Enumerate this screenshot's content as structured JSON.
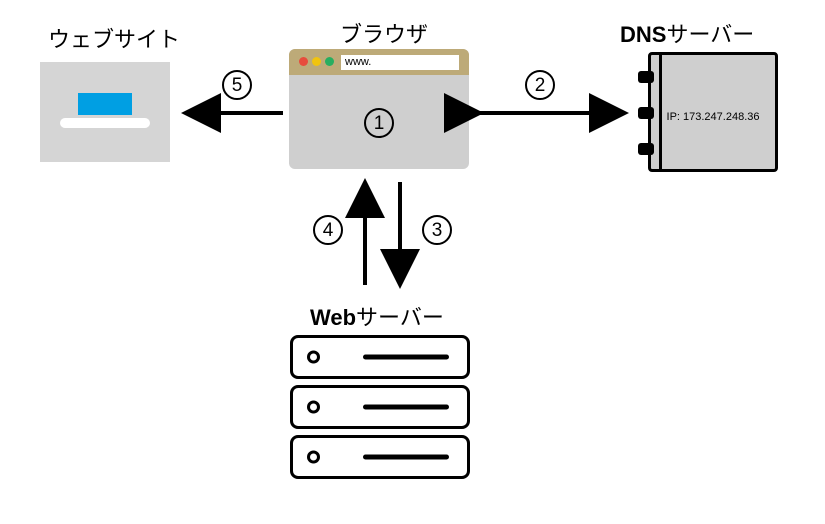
{
  "labels": {
    "website": "ウェブサイト",
    "browser": "ブラウザ",
    "dns_prefix": "DNS",
    "dns_suffix": "サーバー",
    "webserver_prefix": "Web",
    "webserver_suffix": "サーバー"
  },
  "browser": {
    "url_text": "www."
  },
  "dns": {
    "ip_text": "IP: 173.247.248.36"
  },
  "steps": {
    "s1": "①",
    "s2": "②",
    "s3": "③",
    "s4": "④",
    "s5": "⑤",
    "n1": "1",
    "n2": "2",
    "n3": "3",
    "n4": "4",
    "n5": "5"
  }
}
